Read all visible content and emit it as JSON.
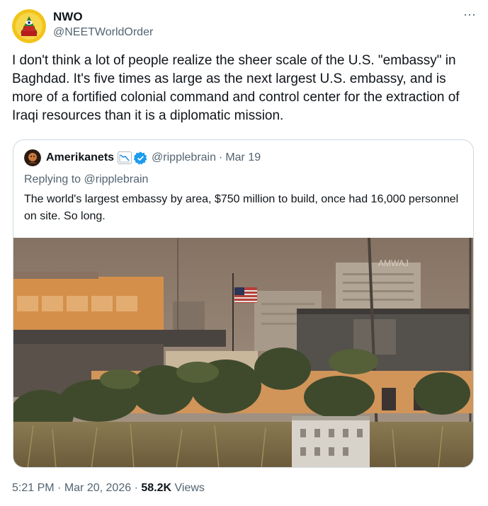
{
  "author": {
    "name": "NWO",
    "handle": "@NEETWorldOrder",
    "avatar_icon": "eye-pyramid-avatar-icon"
  },
  "more_icon": "more-options-icon",
  "more_label": "···",
  "tweet": {
    "text": "I don't think a lot of people realize the sheer scale of the U.S. \"embassy\" in Baghdad. It's five times as large as the next largest U.S. embassy, and is more of a fortified colonial command and control center for the extraction of Iraqi resources than it is a diplomatic mission."
  },
  "quote": {
    "name": "Amerikanets",
    "emoji_icon": "chart-decreasing-icon",
    "verified_icon": "verified-badge-icon",
    "handle": "@ripplebrain",
    "separator": "·",
    "date": "Mar 19",
    "reply_prefix": "Replying to ",
    "reply_handle": "@ripplebrain",
    "text": "The world's largest embassy by area, $750 million to build, once had 16,000 personnel on site. So long.",
    "image": {
      "sign_text": "AMWAJ"
    }
  },
  "meta": {
    "time": "5:21 PM",
    "separator": "·",
    "date": "Mar 20, 2026",
    "views_count": "58.2K",
    "views_label": "Views"
  },
  "colors": {
    "text": "#0f1419",
    "secondary": "#536471",
    "border": "#cfd9de",
    "verified": "#1d9bf0"
  }
}
